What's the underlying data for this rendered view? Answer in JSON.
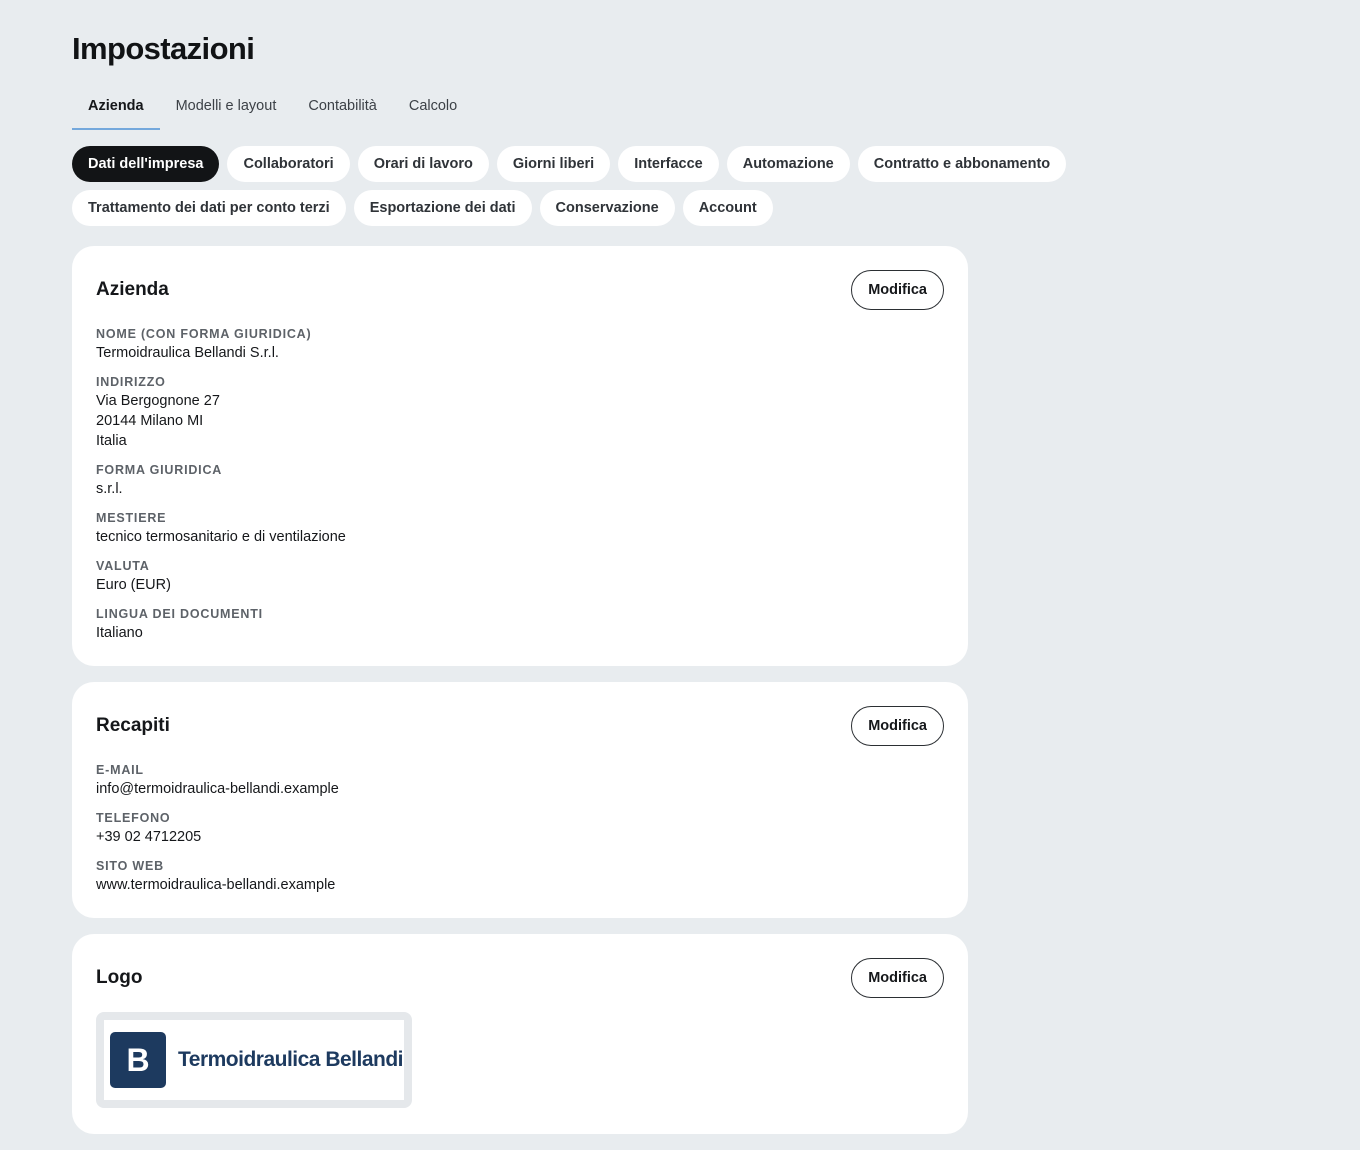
{
  "header": {
    "title": "Impostazioni"
  },
  "tabs": [
    {
      "label": "Azienda",
      "active": true
    },
    {
      "label": "Modelli e layout"
    },
    {
      "label": "Contabilità"
    },
    {
      "label": "Calcolo"
    }
  ],
  "subnav": {
    "row1": [
      "Dati dell'impresa",
      "Collaboratori",
      "Orari di lavoro",
      "Giorni liberi",
      "Interfacce",
      "Automazione",
      "Contratto e abbonamento"
    ],
    "row2": [
      "Trattamento dei dati per conto terzi",
      "Esportazione dei dati",
      "Conservazione",
      "Account"
    ],
    "active": "Dati dell'impresa"
  },
  "company_card": {
    "title": "Azienda",
    "edit_label": "Modifica",
    "fields": [
      {
        "label": "NOME (CON FORMA GIURIDICA)",
        "value": "Termoidraulica Bellandi S.r.l."
      },
      {
        "label": "INDIRIZZO",
        "lines": [
          "Via Bergognone 27",
          "20144 Milano MI",
          "Italia"
        ]
      },
      {
        "label": "FORMA GIURIDICA",
        "value": "s.r.l."
      },
      {
        "label": "MESTIERE",
        "value": "tecnico termosanitario e di ventilazione"
      },
      {
        "label": "VALUTA",
        "value": "Euro (EUR)"
      },
      {
        "label": "LINGUA DEI DOCUMENTI",
        "value": "Italiano"
      }
    ]
  },
  "contacts_card": {
    "title": "Recapiti",
    "edit_label": "Modifica",
    "fields": [
      {
        "label": "E-MAIL",
        "value": "info@termoidraulica-bellandi.example"
      },
      {
        "label": "TELEFONO",
        "value": "+39 02 4712205"
      },
      {
        "label": "SITO WEB",
        "value": "www.termoidraulica-bellandi.example"
      }
    ]
  },
  "logo_card": {
    "title": "Logo",
    "edit_label": "Modifica",
    "logo": {
      "mark": "B",
      "text": "Termoidraulica Bellandi",
      "color": "#1d3a5f"
    }
  },
  "colors": {
    "background": "#e8ecef",
    "active_pill": "#121416",
    "tab_underline": "#74a8dc"
  }
}
